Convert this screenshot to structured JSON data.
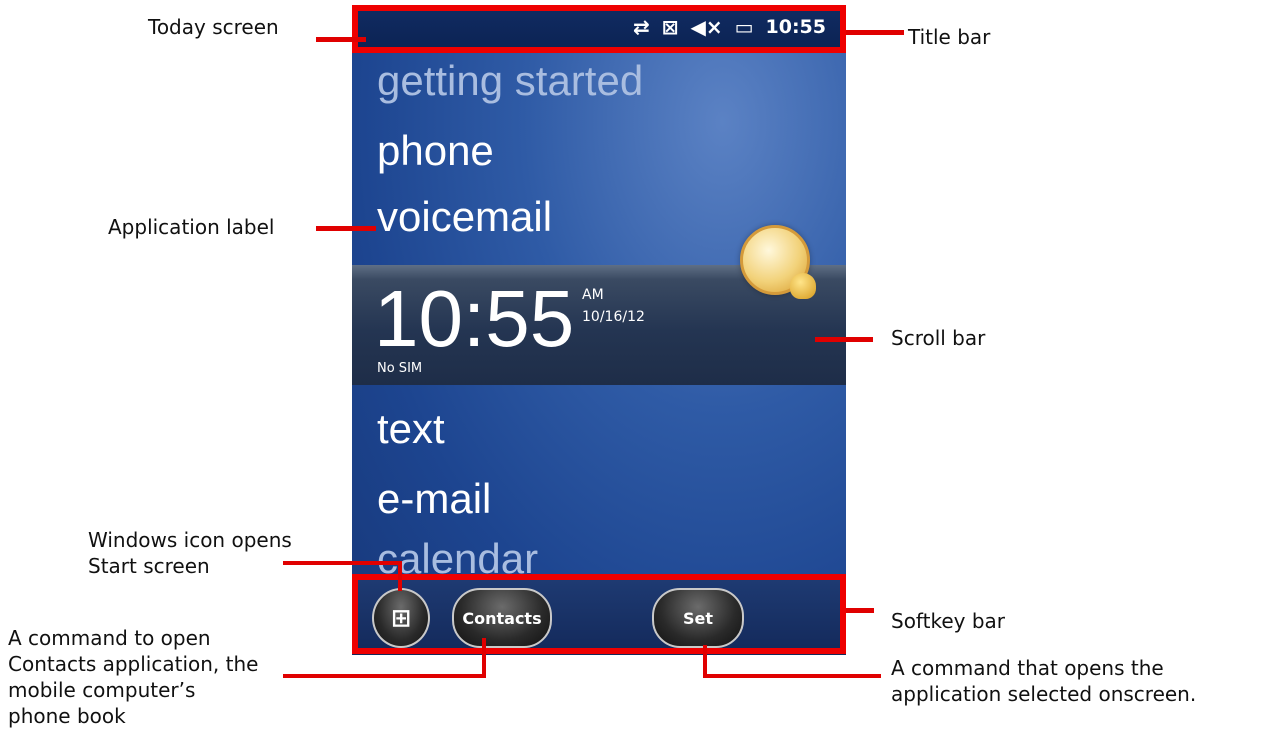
{
  "status_bar": {
    "icons": [
      "sync-arrows-icon",
      "sim-icon",
      "mute-speaker-icon",
      "battery-icon"
    ],
    "time": "10:55"
  },
  "apps_top": [
    "getting started",
    "phone",
    "voicemail"
  ],
  "clock": {
    "time": "10:55",
    "ampm": "AM",
    "date": "10/16/12",
    "sim_status": "No SIM"
  },
  "apps_bottom": [
    "text",
    "e-mail",
    "calendar"
  ],
  "softkeys": {
    "windows": "⊞",
    "contacts": "Contacts",
    "set": "Set"
  },
  "annotations": {
    "today_screen": "Today screen",
    "application_label": "Application label",
    "windows_icon": "Windows icon opens\nStart screen",
    "contacts_cmd": "A command to open\nContacts application, the\nmobile computer’s\nphone book",
    "title_bar": "Title bar",
    "scroll_bar": "Scroll bar",
    "softkey_bar": "Softkey bar",
    "set_cmd": "A command that opens the\napplication selected onscreen."
  },
  "colors": {
    "annotation_red": "#ee0000"
  }
}
